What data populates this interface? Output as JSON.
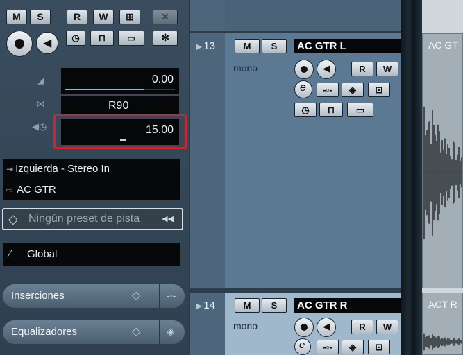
{
  "inspector": {
    "top_buttons": [
      "M",
      "S",
      "R",
      "W",
      "⊞",
      "✕"
    ],
    "volume_value": "0.00",
    "volume_fill": 0.72,
    "pan_value": "R90",
    "delay_value": "15.00",
    "delay_fill": 0.5,
    "input_route": "Izquierda - Stereo In",
    "output_route": "AC GTR",
    "preset_placeholder": "Ningún preset de pista",
    "preset_button": "◀◀",
    "automation_label": "Global",
    "sections": [
      {
        "label": "Inserciones"
      },
      {
        "label": "Equalizadores"
      }
    ]
  },
  "tracks": [
    {
      "number": "13",
      "name": "AC GTR L",
      "channel": "mono",
      "mute": "M",
      "solo": "S",
      "read": "R",
      "write": "W"
    },
    {
      "number": "14",
      "name": "AC GTR R",
      "channel": "mono",
      "mute": "M",
      "solo": "S",
      "read": "R",
      "write": "W"
    }
  ],
  "events": [
    {
      "label": "AC GT"
    },
    {
      "label": "ACT R"
    }
  ]
}
